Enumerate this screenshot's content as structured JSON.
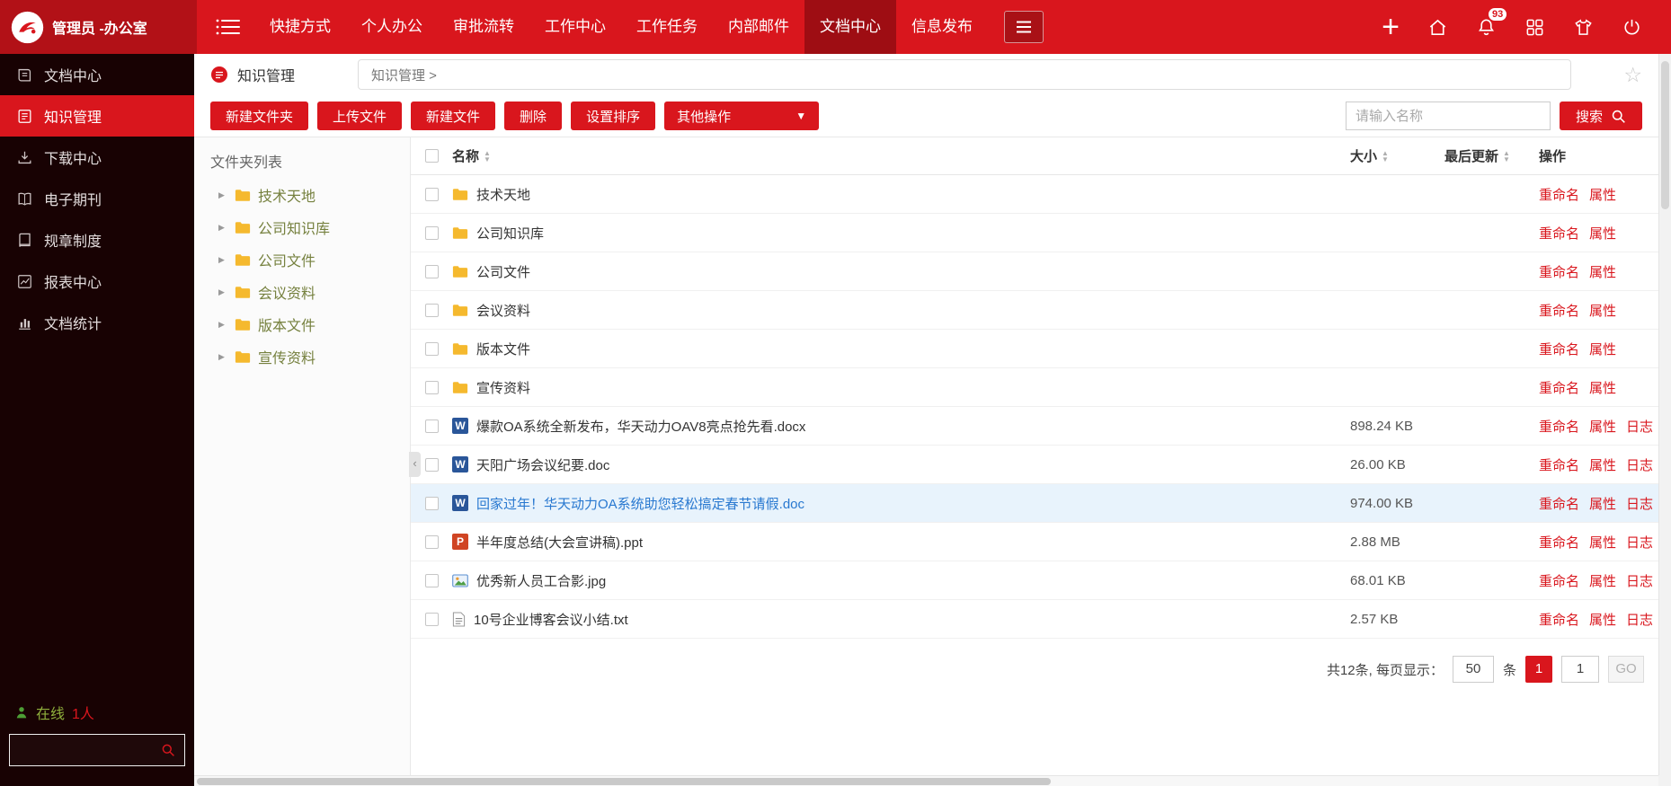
{
  "topbar": {
    "user_label": "管理员 -办公室",
    "nav": [
      {
        "label": "快捷方式",
        "active": false
      },
      {
        "label": "个人办公",
        "active": false
      },
      {
        "label": "审批流转",
        "active": false
      },
      {
        "label": "工作中心",
        "active": false
      },
      {
        "label": "工作任务",
        "active": false
      },
      {
        "label": "内部邮件",
        "active": false
      },
      {
        "label": "文档中心",
        "active": true
      },
      {
        "label": "信息发布",
        "active": false
      }
    ],
    "notification_badge": "93"
  },
  "sidebar": {
    "items": [
      {
        "label": "文档中心",
        "icon": "document-center-icon",
        "active": false
      },
      {
        "label": "知识管理",
        "icon": "knowledge-icon",
        "active": true
      },
      {
        "label": "下载中心",
        "icon": "download-icon",
        "active": false
      },
      {
        "label": "电子期刊",
        "icon": "journal-icon",
        "active": false
      },
      {
        "label": "规章制度",
        "icon": "rules-icon",
        "active": false
      },
      {
        "label": "报表中心",
        "icon": "report-icon",
        "active": false
      },
      {
        "label": "文档统计",
        "icon": "stats-icon",
        "active": false
      }
    ],
    "online_label": "在线",
    "online_count": "1人"
  },
  "header": {
    "module_label": "知识管理",
    "breadcrumb": "知识管理 >"
  },
  "toolbar": {
    "buttons": [
      {
        "label": "新建文件夹"
      },
      {
        "label": "上传文件"
      },
      {
        "label": "新建文件"
      },
      {
        "label": "删除"
      },
      {
        "label": "设置排序"
      }
    ],
    "more_button": "其他操作",
    "search_placeholder": "请输入名称",
    "search_label": "搜索"
  },
  "folder_pane": {
    "title": "文件夹列表",
    "folders": [
      {
        "label": "技术天地"
      },
      {
        "label": "公司知识库"
      },
      {
        "label": "公司文件"
      },
      {
        "label": "会议资料"
      },
      {
        "label": "版本文件"
      },
      {
        "label": "宣传资料"
      }
    ]
  },
  "table": {
    "headers": {
      "name": "名称",
      "size": "大小",
      "updated": "最后更新",
      "actions": "操作"
    },
    "rows": [
      {
        "name": "技术天地",
        "type": "folder",
        "size": "",
        "updated": "",
        "actions": [
          "重命名",
          "属性"
        ],
        "selected": false
      },
      {
        "name": "公司知识库",
        "type": "folder",
        "size": "",
        "updated": "",
        "actions": [
          "重命名",
          "属性"
        ],
        "selected": false
      },
      {
        "name": "公司文件",
        "type": "folder",
        "size": "",
        "updated": "",
        "actions": [
          "重命名",
          "属性"
        ],
        "selected": false
      },
      {
        "name": "会议资料",
        "type": "folder",
        "size": "",
        "updated": "",
        "actions": [
          "重命名",
          "属性"
        ],
        "selected": false
      },
      {
        "name": "版本文件",
        "type": "folder",
        "size": "",
        "updated": "",
        "actions": [
          "重命名",
          "属性"
        ],
        "selected": false
      },
      {
        "name": "宣传资料",
        "type": "folder",
        "size": "",
        "updated": "",
        "actions": [
          "重命名",
          "属性"
        ],
        "selected": false
      },
      {
        "name": "爆款OA系统全新发布，华天动力OAV8亮点抢先看.docx",
        "type": "doc",
        "size": "898.24 KB",
        "updated": "",
        "actions": [
          "重命名",
          "属性",
          "日志"
        ],
        "selected": false
      },
      {
        "name": "天阳广场会议纪要.doc",
        "type": "doc",
        "size": "26.00 KB",
        "updated": "",
        "actions": [
          "重命名",
          "属性",
          "日志"
        ],
        "selected": false
      },
      {
        "name": "回家过年！华天动力OA系统助您轻松搞定春节请假.doc",
        "type": "doc",
        "size": "974.00 KB",
        "updated": "",
        "actions": [
          "重命名",
          "属性",
          "日志"
        ],
        "selected": true
      },
      {
        "name": "半年度总结(大会宣讲稿).ppt",
        "type": "ppt",
        "size": "2.88 MB",
        "updated": "",
        "actions": [
          "重命名",
          "属性",
          "日志"
        ],
        "selected": false
      },
      {
        "name": "优秀新人员工合影.jpg",
        "type": "image",
        "size": "68.01 KB",
        "updated": "",
        "actions": [
          "重命名",
          "属性",
          "日志"
        ],
        "selected": false
      },
      {
        "name": "10号企业博客会议小结.txt",
        "type": "txt",
        "size": "2.57 KB",
        "updated": "",
        "actions": [
          "重命名",
          "属性",
          "日志"
        ],
        "selected": false
      }
    ]
  },
  "pagination": {
    "summary": "共12条, 每页显示：",
    "page_size": "50",
    "unit": "条",
    "current_page": "1",
    "page_input": "1",
    "go_label": "GO"
  },
  "colors": {
    "primary_red": "#d9161d",
    "dark_red": "#9e0d13",
    "link_blue": "#2878d0",
    "selected_row_bg": "#e8f3fc",
    "folder_yellow": "#f5b92e",
    "online_green": "#8faf3c",
    "tree_text_olive": "#76813f"
  }
}
